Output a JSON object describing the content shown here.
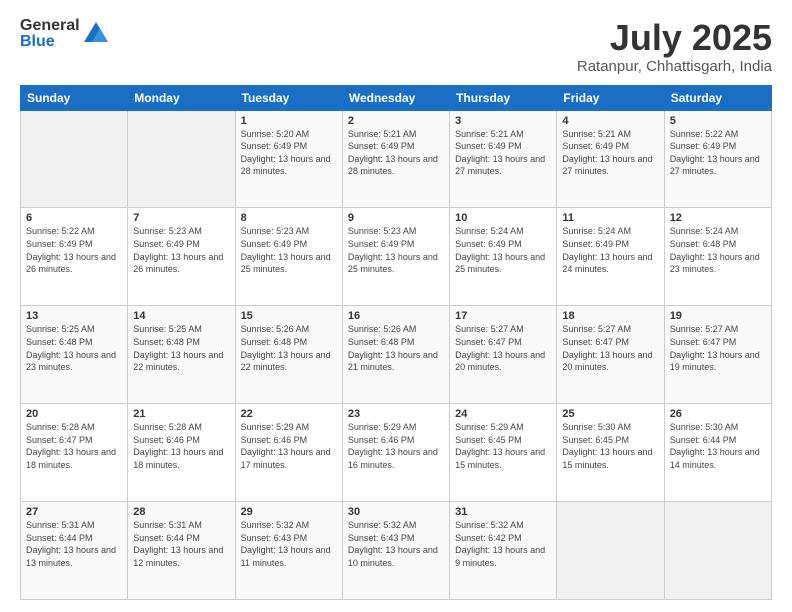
{
  "header": {
    "logo_general": "General",
    "logo_blue": "Blue",
    "month_title": "July 2025",
    "location": "Ratanpur, Chhattisgarh, India"
  },
  "days_of_week": [
    "Sunday",
    "Monday",
    "Tuesday",
    "Wednesday",
    "Thursday",
    "Friday",
    "Saturday"
  ],
  "weeks": [
    [
      {
        "day": "",
        "sunrise": "",
        "sunset": "",
        "daylight": ""
      },
      {
        "day": "",
        "sunrise": "",
        "sunset": "",
        "daylight": ""
      },
      {
        "day": "1",
        "sunrise": "Sunrise: 5:20 AM",
        "sunset": "Sunset: 6:49 PM",
        "daylight": "Daylight: 13 hours and 28 minutes."
      },
      {
        "day": "2",
        "sunrise": "Sunrise: 5:21 AM",
        "sunset": "Sunset: 6:49 PM",
        "daylight": "Daylight: 13 hours and 28 minutes."
      },
      {
        "day": "3",
        "sunrise": "Sunrise: 5:21 AM",
        "sunset": "Sunset: 6:49 PM",
        "daylight": "Daylight: 13 hours and 27 minutes."
      },
      {
        "day": "4",
        "sunrise": "Sunrise: 5:21 AM",
        "sunset": "Sunset: 6:49 PM",
        "daylight": "Daylight: 13 hours and 27 minutes."
      },
      {
        "day": "5",
        "sunrise": "Sunrise: 5:22 AM",
        "sunset": "Sunset: 6:49 PM",
        "daylight": "Daylight: 13 hours and 27 minutes."
      }
    ],
    [
      {
        "day": "6",
        "sunrise": "Sunrise: 5:22 AM",
        "sunset": "Sunset: 6:49 PM",
        "daylight": "Daylight: 13 hours and 26 minutes."
      },
      {
        "day": "7",
        "sunrise": "Sunrise: 5:23 AM",
        "sunset": "Sunset: 6:49 PM",
        "daylight": "Daylight: 13 hours and 26 minutes."
      },
      {
        "day": "8",
        "sunrise": "Sunrise: 5:23 AM",
        "sunset": "Sunset: 6:49 PM",
        "daylight": "Daylight: 13 hours and 25 minutes."
      },
      {
        "day": "9",
        "sunrise": "Sunrise: 5:23 AM",
        "sunset": "Sunset: 6:49 PM",
        "daylight": "Daylight: 13 hours and 25 minutes."
      },
      {
        "day": "10",
        "sunrise": "Sunrise: 5:24 AM",
        "sunset": "Sunset: 6:49 PM",
        "daylight": "Daylight: 13 hours and 25 minutes."
      },
      {
        "day": "11",
        "sunrise": "Sunrise: 5:24 AM",
        "sunset": "Sunset: 6:49 PM",
        "daylight": "Daylight: 13 hours and 24 minutes."
      },
      {
        "day": "12",
        "sunrise": "Sunrise: 5:24 AM",
        "sunset": "Sunset: 6:48 PM",
        "daylight": "Daylight: 13 hours and 23 minutes."
      }
    ],
    [
      {
        "day": "13",
        "sunrise": "Sunrise: 5:25 AM",
        "sunset": "Sunset: 6:48 PM",
        "daylight": "Daylight: 13 hours and 23 minutes."
      },
      {
        "day": "14",
        "sunrise": "Sunrise: 5:25 AM",
        "sunset": "Sunset: 6:48 PM",
        "daylight": "Daylight: 13 hours and 22 minutes."
      },
      {
        "day": "15",
        "sunrise": "Sunrise: 5:26 AM",
        "sunset": "Sunset: 6:48 PM",
        "daylight": "Daylight: 13 hours and 22 minutes."
      },
      {
        "day": "16",
        "sunrise": "Sunrise: 5:26 AM",
        "sunset": "Sunset: 6:48 PM",
        "daylight": "Daylight: 13 hours and 21 minutes."
      },
      {
        "day": "17",
        "sunrise": "Sunrise: 5:27 AM",
        "sunset": "Sunset: 6:47 PM",
        "daylight": "Daylight: 13 hours and 20 minutes."
      },
      {
        "day": "18",
        "sunrise": "Sunrise: 5:27 AM",
        "sunset": "Sunset: 6:47 PM",
        "daylight": "Daylight: 13 hours and 20 minutes."
      },
      {
        "day": "19",
        "sunrise": "Sunrise: 5:27 AM",
        "sunset": "Sunset: 6:47 PM",
        "daylight": "Daylight: 13 hours and 19 minutes."
      }
    ],
    [
      {
        "day": "20",
        "sunrise": "Sunrise: 5:28 AM",
        "sunset": "Sunset: 6:47 PM",
        "daylight": "Daylight: 13 hours and 18 minutes."
      },
      {
        "day": "21",
        "sunrise": "Sunrise: 5:28 AM",
        "sunset": "Sunset: 6:46 PM",
        "daylight": "Daylight: 13 hours and 18 minutes."
      },
      {
        "day": "22",
        "sunrise": "Sunrise: 5:29 AM",
        "sunset": "Sunset: 6:46 PM",
        "daylight": "Daylight: 13 hours and 17 minutes."
      },
      {
        "day": "23",
        "sunrise": "Sunrise: 5:29 AM",
        "sunset": "Sunset: 6:46 PM",
        "daylight": "Daylight: 13 hours and 16 minutes."
      },
      {
        "day": "24",
        "sunrise": "Sunrise: 5:29 AM",
        "sunset": "Sunset: 6:45 PM",
        "daylight": "Daylight: 13 hours and 15 minutes."
      },
      {
        "day": "25",
        "sunrise": "Sunrise: 5:30 AM",
        "sunset": "Sunset: 6:45 PM",
        "daylight": "Daylight: 13 hours and 15 minutes."
      },
      {
        "day": "26",
        "sunrise": "Sunrise: 5:30 AM",
        "sunset": "Sunset: 6:44 PM",
        "daylight": "Daylight: 13 hours and 14 minutes."
      }
    ],
    [
      {
        "day": "27",
        "sunrise": "Sunrise: 5:31 AM",
        "sunset": "Sunset: 6:44 PM",
        "daylight": "Daylight: 13 hours and 13 minutes."
      },
      {
        "day": "28",
        "sunrise": "Sunrise: 5:31 AM",
        "sunset": "Sunset: 6:44 PM",
        "daylight": "Daylight: 13 hours and 12 minutes."
      },
      {
        "day": "29",
        "sunrise": "Sunrise: 5:32 AM",
        "sunset": "Sunset: 6:43 PM",
        "daylight": "Daylight: 13 hours and 11 minutes."
      },
      {
        "day": "30",
        "sunrise": "Sunrise: 5:32 AM",
        "sunset": "Sunset: 6:43 PM",
        "daylight": "Daylight: 13 hours and 10 minutes."
      },
      {
        "day": "31",
        "sunrise": "Sunrise: 5:32 AM",
        "sunset": "Sunset: 6:42 PM",
        "daylight": "Daylight: 13 hours and 9 minutes."
      },
      {
        "day": "",
        "sunrise": "",
        "sunset": "",
        "daylight": ""
      },
      {
        "day": "",
        "sunrise": "",
        "sunset": "",
        "daylight": ""
      }
    ]
  ]
}
